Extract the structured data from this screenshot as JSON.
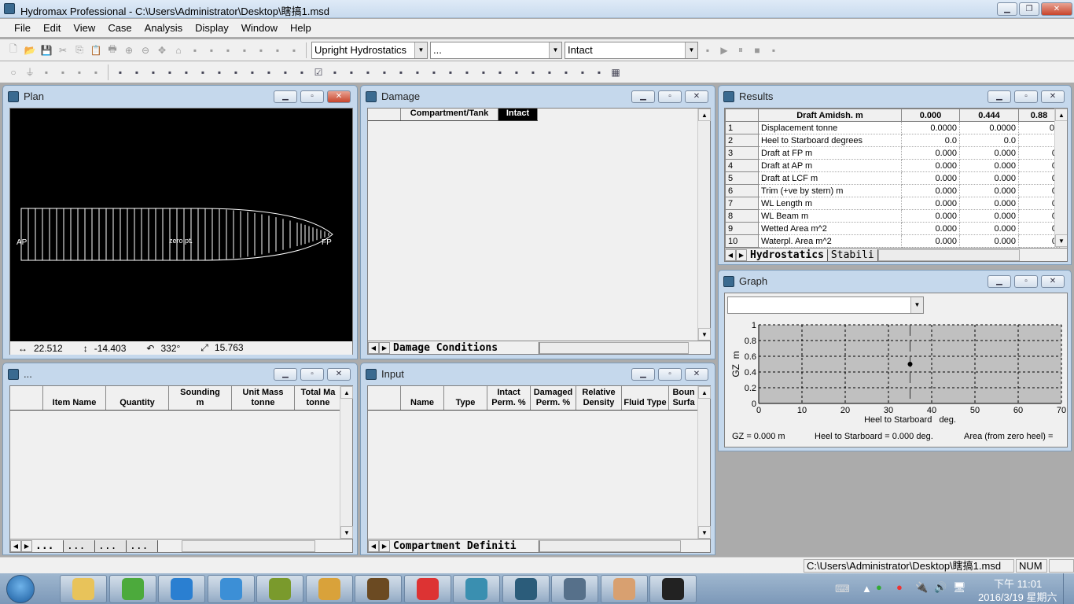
{
  "window": {
    "title": "Hydromax Professional - C:\\Users\\Administrator\\Desktop\\瞎搞1.msd",
    "controls": {
      "minimize": "▁",
      "restore": "❐",
      "close": "✕"
    }
  },
  "menu": [
    "File",
    "Edit",
    "View",
    "Case",
    "Analysis",
    "Display",
    "Window",
    "Help"
  ],
  "toolbar": {
    "analysis_type": "Upright Hydrostatics",
    "secondary_combo": "...",
    "condition_combo": "Intact",
    "icons_row1": [
      "new-icon",
      "open-icon",
      "save-icon",
      "cut-icon",
      "copy-icon",
      "paste-icon",
      "print-icon",
      "zoom-in-icon",
      "zoom-out-icon",
      "pan-icon",
      "home-icon",
      "rotate-icon",
      "view-icon",
      "table-icon",
      "table2-icon",
      "sort-icon",
      "columns-icon",
      "columns2-icon"
    ],
    "icons_row1_right": [
      "settings-icon",
      "play-icon",
      "pause-icon",
      "stop-icon",
      "options-icon"
    ],
    "icons_row2": [
      "circle-icon",
      "filter-icon",
      "section-icon",
      "body-icon",
      "plan-icon",
      "perspective-icon"
    ],
    "icons_row2_mid": [
      "tank-icon",
      "tank2-icon",
      "tank3-icon",
      "tank4-icon",
      "link-icon",
      "link2-icon",
      "link3-icon",
      "link4-icon",
      "link5-icon",
      "link6-icon",
      "link7-icon",
      "window-icon",
      "check-icon",
      "image-icon",
      "curve-icon",
      "doc-icon",
      "select-icon",
      "shape1-icon",
      "shape2-icon",
      "shape3-icon",
      "paint-icon",
      "layer-icon",
      "box-icon",
      "xbox-icon",
      "box2-icon",
      "xbox2-icon",
      "frame-icon",
      "monitor-icon",
      "tag-icon",
      "disk-icon",
      "grid-icon"
    ]
  },
  "plan": {
    "title": "Plan",
    "labels": {
      "ap": "AP",
      "zero": "zero pt.",
      "fp": "FP"
    },
    "readouts": [
      {
        "icon": "horizontal-arrows-icon",
        "glyph": "↔",
        "value": "22.512"
      },
      {
        "icon": "vertical-arrows-icon",
        "glyph": "↕",
        "value": "-14.403"
      },
      {
        "icon": "rotate-icon",
        "glyph": "↶",
        "value": "332°"
      },
      {
        "icon": "zoom-diagonal-icon",
        "glyph": "⤢",
        "value": "15.763"
      }
    ]
  },
  "damage": {
    "title": "Damage",
    "columns": [
      "Compartment/Tank",
      "Intact"
    ],
    "tabs": [
      "Damage Conditions"
    ]
  },
  "results": {
    "title": "Results",
    "header": [
      "Draft Amidsh. m",
      "0.000",
      "0.444",
      "0.88"
    ],
    "rows": [
      {
        "n": "1",
        "label": "Displacement tonne",
        "v": [
          "0.0000",
          "0.0000",
          "0."
        ]
      },
      {
        "n": "2",
        "label": "Heel to Starboard degrees",
        "v": [
          "0.0",
          "0.0",
          ""
        ]
      },
      {
        "n": "3",
        "label": "Draft at FP m",
        "v": [
          "0.000",
          "0.000",
          "0"
        ]
      },
      {
        "n": "4",
        "label": "Draft at AP m",
        "v": [
          "0.000",
          "0.000",
          "0"
        ]
      },
      {
        "n": "5",
        "label": "Draft at LCF m",
        "v": [
          "0.000",
          "0.000",
          "0"
        ]
      },
      {
        "n": "6",
        "label": "Trim (+ve by stern) m",
        "v": [
          "0.000",
          "0.000",
          "0"
        ]
      },
      {
        "n": "7",
        "label": "WL Length m",
        "v": [
          "0.000",
          "0.000",
          "0"
        ]
      },
      {
        "n": "8",
        "label": "WL Beam m",
        "v": [
          "0.000",
          "0.000",
          "0"
        ]
      },
      {
        "n": "9",
        "label": "Wetted Area m^2",
        "v": [
          "0.000",
          "0.000",
          "0"
        ]
      },
      {
        "n": "10",
        "label": "Waterpl. Area m^2",
        "v": [
          "0.000",
          "0.000",
          "0"
        ]
      }
    ],
    "tabs": [
      "Hydrostatics",
      "Stabili"
    ]
  },
  "graph": {
    "title": "Graph",
    "selector": "",
    "footer": {
      "gz": "GZ =  0.000 m",
      "heel": "Heel to Starboard =  0.000  deg.",
      "area": "Area (from zero heel) ="
    }
  },
  "chart_data": {
    "type": "scatter",
    "xlabel": "Heel to Starboard   deg.",
    "ylabel": "GZ  m",
    "xlim": [
      0,
      70
    ],
    "ylim": [
      0,
      1
    ],
    "xticks": [
      0,
      10,
      20,
      30,
      40,
      50,
      60,
      70
    ],
    "yticks": [
      0,
      0.2,
      0.4,
      0.6,
      0.8,
      1
    ],
    "grid": true,
    "background": "#c0c0c0",
    "points": [
      {
        "x": 35,
        "y": 0.5
      }
    ],
    "marker_line_x": 35
  },
  "loads": {
    "title": "...",
    "columns": [
      "",
      "Item Name",
      "Quantity",
      "Sounding\nm",
      "Unit Mass\ntonne",
      "Total Ma\ntonne"
    ],
    "tabs": [
      "...",
      "...",
      "...",
      "..."
    ]
  },
  "input": {
    "title": "Input",
    "columns": [
      "",
      "Name",
      "Type",
      "Intact\nPerm. %",
      "Damaged\nPerm. %",
      "Relative\nDensity",
      "Fluid Type",
      "Boun\nSurfa"
    ],
    "tabs": [
      "Compartment Definiti"
    ]
  },
  "status": {
    "path": "C:\\Users\\Administrator\\Desktop\\瞎搞1.msd",
    "num": "NUM"
  },
  "taskbar": {
    "apps": [
      "file-explorer",
      "ie-browser",
      "media-player",
      "baidu-cloud",
      "app-green",
      "qq-game",
      "warcraft",
      "pdf-reader",
      "app-a",
      "app-ornament",
      "hydromax",
      "paint",
      "panda"
    ],
    "tray": {
      "time": "下午 11:01",
      "date": "2016/3/19 星期六"
    }
  }
}
